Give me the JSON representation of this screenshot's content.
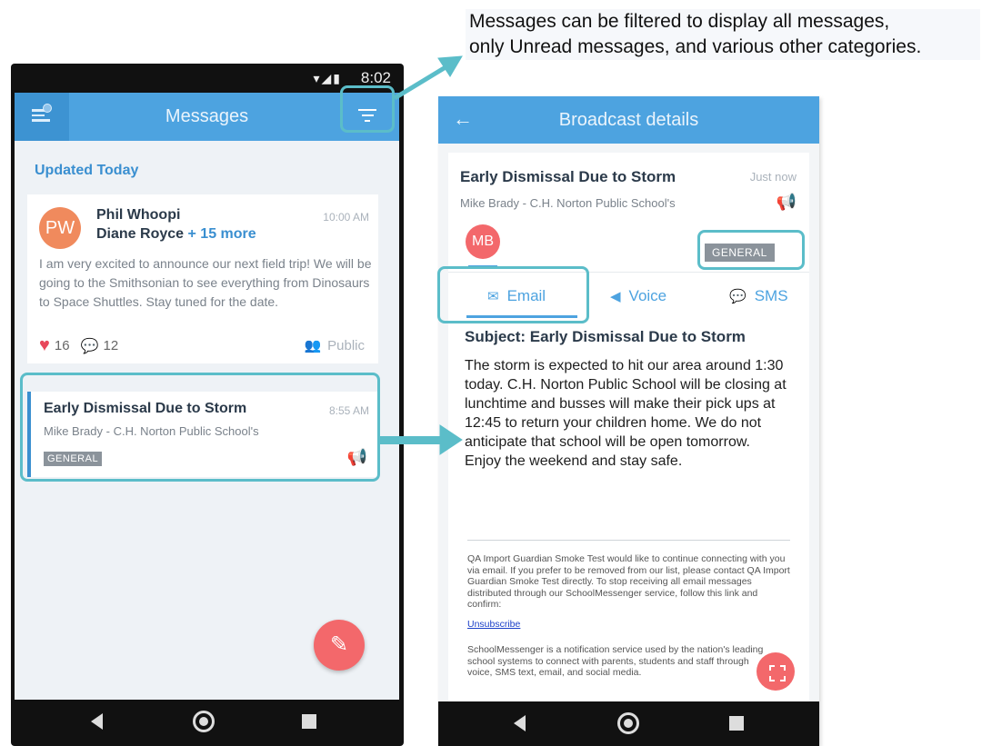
{
  "callout": {
    "line1": "Messages can be filtered to display all messages,",
    "line2": "only Unread messages, and various other categories."
  },
  "left_phone": {
    "status_time": "8:02",
    "app_title": "Messages",
    "section_header": "Updated Today",
    "card1": {
      "avatar_initials": "PW",
      "sender": "Phil Whoopi",
      "recipient": "Diane Royce",
      "recipient_more": "+ 15 more",
      "time": "10:00 AM",
      "body": "I am very excited to announce our next field trip! We will be going to the Smithsonian to see everything from Dinosaurs to Space Shuttles. Stay tuned for the date.",
      "likes": "16",
      "comments": "12",
      "visibility": "Public"
    },
    "card2": {
      "title": "Early Dismissal Due to Storm",
      "from": "Mike Brady - C.H. Norton Public School's",
      "time": "8:55 AM",
      "badge": "GENERAL"
    }
  },
  "right_phone": {
    "app_title": "Broadcast details",
    "title": "Early Dismissal Due to Storm",
    "time": "Just now",
    "from": "Mike Brady - C.H. Norton Public School's",
    "avatar_initials": "MB",
    "badge": "GENERAL",
    "tabs": {
      "email": "Email",
      "voice": "Voice",
      "sms": "SMS"
    },
    "subject": "Subject: Early Dismissal Due to Storm",
    "body": "The storm is expected to hit our area around 1:30 today. C.H. Norton Public School will be closing at lunchtime and busses will make their pick ups at 12:45 to return your children home. We do not anticipate that school will be open tomorrow.\nEnjoy the weekend and stay safe.",
    "footer1": "QA Import Guardian Smoke Test would like to continue connecting with you via email. If you prefer to be removed from our list, please contact QA Import Guardian Smoke Test directly. To stop receiving all email messages distributed through our SchoolMessenger service, follow this link and confirm:",
    "unsubscribe": "Unsubscribe",
    "footer2": "SchoolMessenger is a notification service used by the nation's leading school systems to connect with parents, students and staff through voice, SMS text, email, and social media."
  },
  "icons": {
    "menu": "menu-icon",
    "filter": "filter-icon",
    "back": "back-arrow-icon",
    "megaphone": "megaphone-icon",
    "compose": "pencil-icon",
    "expand": "expand-icon"
  },
  "colors": {
    "primary": "#4da3e0",
    "accent": "#f3686b",
    "highlight": "#5bbdc9",
    "badge": "#8b939b"
  }
}
